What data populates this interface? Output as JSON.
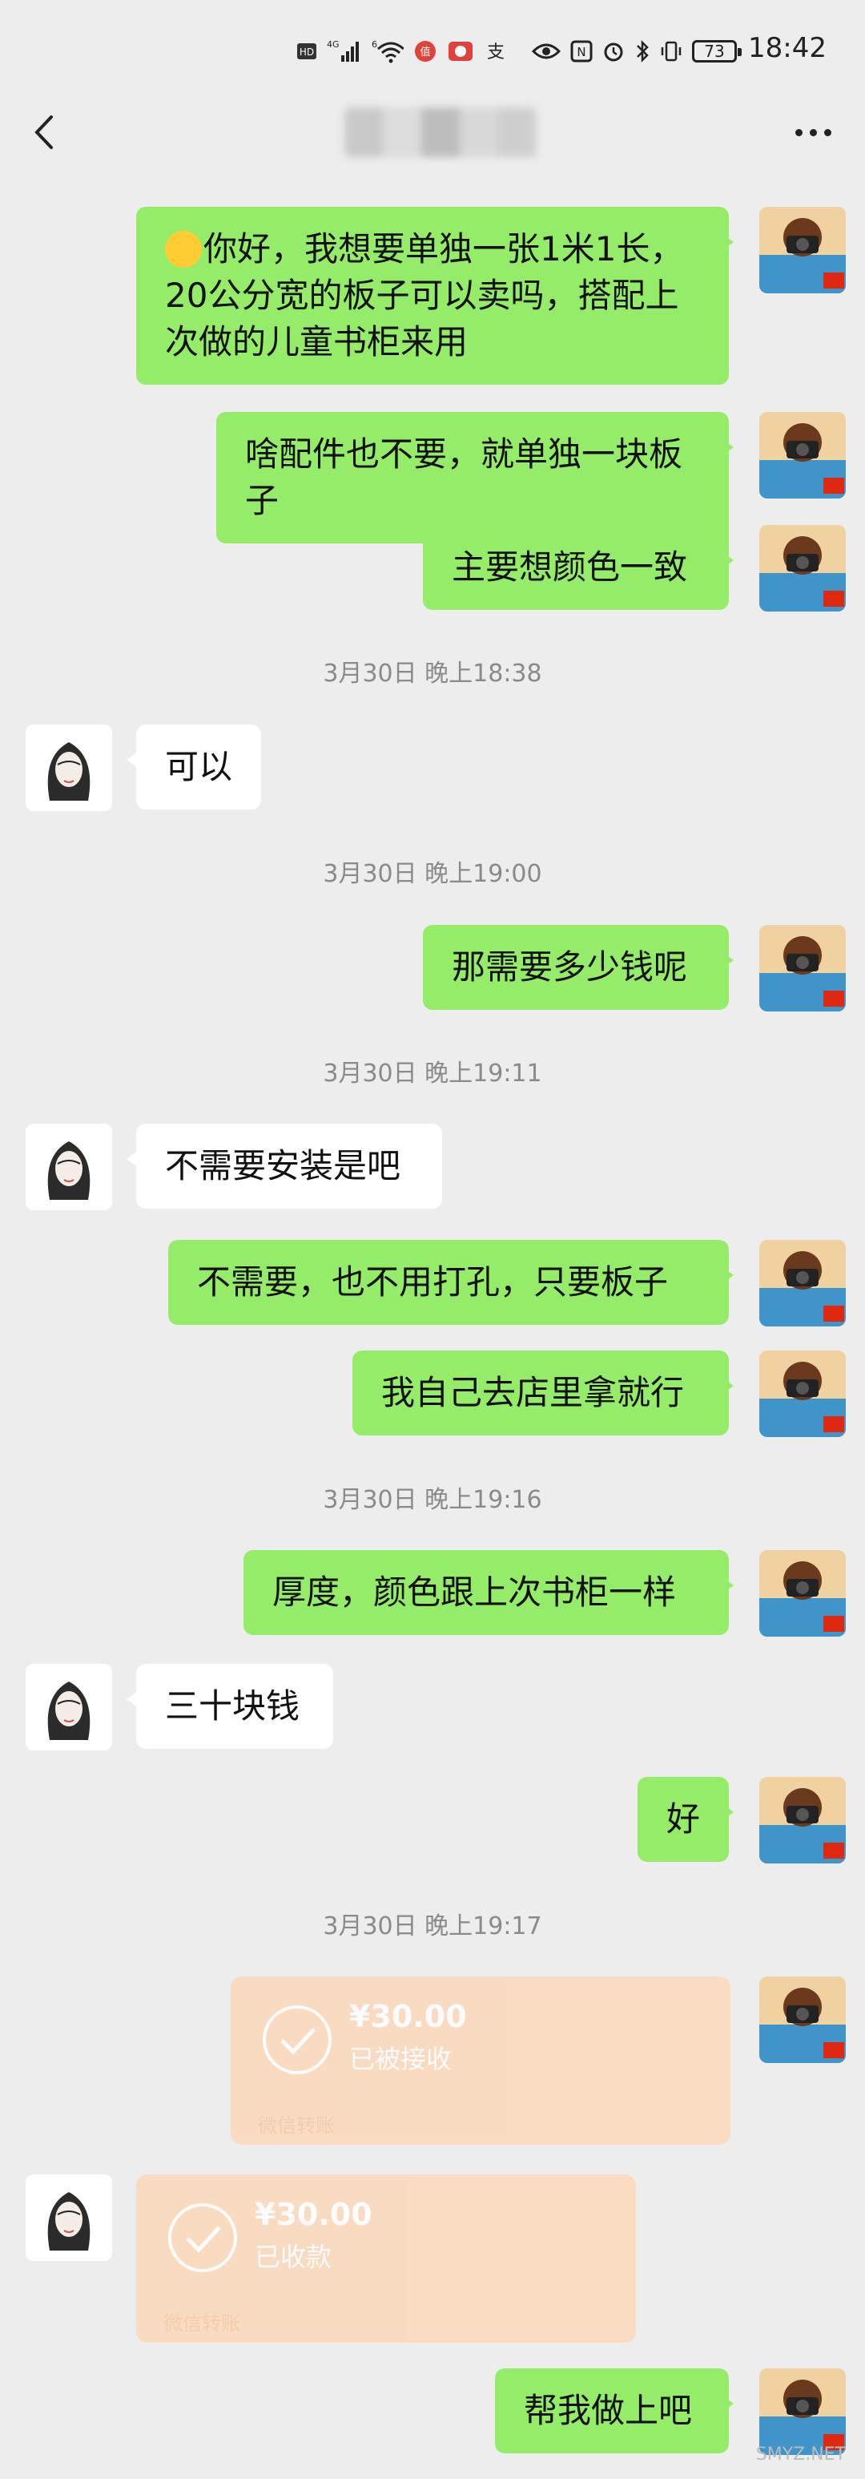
{
  "status_bar": {
    "time": "18:42",
    "battery": "73",
    "network": "4G"
  },
  "nav": {
    "title": ""
  },
  "messages": [
    {
      "type": "me",
      "text": "你好，我想要单独一张1米1长，20公分宽的板子可以卖吗，搭配上次做的儿童书柜来用"
    },
    {
      "type": "me",
      "text": "啥配件也不要，就单独一块板子"
    },
    {
      "type": "me",
      "text": "主要想颜色一致"
    },
    {
      "type": "time",
      "text": "3月30日 晚上18:38"
    },
    {
      "type": "her",
      "text": "可以"
    },
    {
      "type": "time",
      "text": "3月30日 晚上19:00"
    },
    {
      "type": "me",
      "text": "那需要多少钱呢"
    },
    {
      "type": "time",
      "text": "3月30日 晚上19:11"
    },
    {
      "type": "her",
      "text": "不需要安装是吧"
    },
    {
      "type": "me",
      "text": "不需要，也不用打孔，只要板子"
    },
    {
      "type": "me",
      "text": "我自己去店里拿就行"
    },
    {
      "type": "time",
      "text": "3月30日 晚上19:16"
    },
    {
      "type": "me",
      "text": "厚度，颜色跟上次书柜一样"
    },
    {
      "type": "her",
      "text": "三十块钱"
    },
    {
      "type": "me",
      "text": "好"
    },
    {
      "type": "time",
      "text": "3月30日 晚上19:17"
    },
    {
      "type": "me_transfer",
      "amount": "¥30.00",
      "status": "已被接收",
      "footer": "微信转账"
    },
    {
      "type": "her_transfer",
      "amount": "¥30.00",
      "status": "已收款",
      "footer": "微信转账"
    },
    {
      "type": "me",
      "text": "帮我做上吧"
    }
  ],
  "watermark": "SMYZ.NET",
  "colors": {
    "me_bubble": "#95ec69",
    "her_bubble": "#ffffff",
    "transfer": "#fbd8ba",
    "background": "#ededed"
  }
}
